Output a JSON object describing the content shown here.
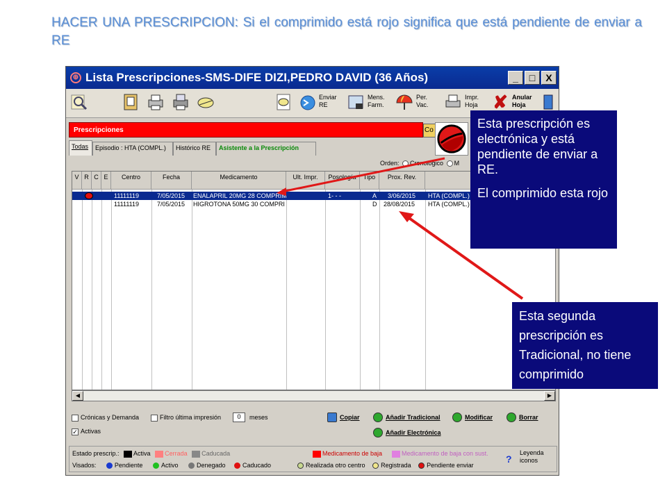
{
  "slide": {
    "title": "HACER UNA PRESCRIPCION: Si el comprimido está rojo significa que está pendiente de enviar a RE"
  },
  "window": {
    "title": "Lista Prescripciones-SMS-DIFE DIZI,PEDRO DAVID (36 Años)",
    "minimize": "_",
    "maximize": "□",
    "close": "X"
  },
  "toolbar": {
    "enviar_re": "Enviar\nRE",
    "mens_farm": "Mens.\nFarm.",
    "per_vac": "Per.\nVac.",
    "impr_hoja": "Impr.\nHoja",
    "anular_hoja": "Anular\nHoja"
  },
  "panel": {
    "header": "Prescripciones",
    "side_button": "Co"
  },
  "tabs": [
    "Todas",
    "Episodio : HTA (COMPL.)",
    "Histórico RE",
    "Asistente a la Prescripción"
  ],
  "order": {
    "label": "Orden:",
    "option1": "Cronológico",
    "option2": "M"
  },
  "table": {
    "columns": [
      "V",
      "R",
      "C",
      "E",
      "Centro",
      "Fecha",
      "Medicamento",
      "Ult. Impr.",
      "Posología",
      "Tipo",
      "Prox. Rev.",
      ""
    ],
    "rows": [
      {
        "centro": "11111119",
        "fecha": "7/05/2015",
        "medicamento": "ENALAPRIL 20MG 28 COMPRIM",
        "ult_impr": "",
        "posologia": "1- - -",
        "tipo": "A",
        "prox_rev": "3/06/2015",
        "episodio": "HTA (COMPL.)",
        "selected": true,
        "pending_pill": true
      },
      {
        "centro": "11111119",
        "fecha": "7/05/2015",
        "medicamento": "HIGROTONA 50MG 30 COMPRI",
        "ult_impr": "",
        "posologia": "",
        "tipo": "D",
        "prox_rev": "28/08/2015",
        "episodio": "HTA (COMPL.)",
        "selected": false,
        "pending_pill": false
      }
    ]
  },
  "filters": {
    "cronicas": "Crónicas y Demanda",
    "filtro": "Filtro última impresión",
    "meses_value": "0",
    "meses": "meses",
    "activas": "Activas"
  },
  "actions": {
    "copiar": "Copiar",
    "anadir_tradicional": "Añadir Tradicional",
    "modificar": "Modificar",
    "borrar": "Borrar",
    "anadir_electronica": "Añadir Electrónica"
  },
  "legend": {
    "estado_label": "Estado prescrip.:",
    "activa": "Activa",
    "cerrada": "Cerrada",
    "caducada": "Caducada",
    "med_baja": "Medicamento de baja",
    "med_baja_sust": "Medicamento de baja con sust.",
    "visados_label": "Visados:",
    "pendiente": "Pendiente",
    "activo": "Activo",
    "denegado": "Denegado",
    "caducado": "Caducado",
    "realizada": "Realizada otro centro",
    "registrada": "Registrada",
    "pendiente_enviar": "Pendiente enviar",
    "help": "?",
    "leyenda": "Leyenda\niconos"
  },
  "callouts": {
    "c1_line1": "Esta prescripción es electrónica y está pendiente de enviar a RE.",
    "c1_line2": "El comprimido esta rojo",
    "c2": "Esta segunda prescripción es Tradicional, no tiene comprimido"
  },
  "colors": {
    "title_blue": "#5b8fd6",
    "callout_bg": "#0a0a7a",
    "arrow_red": "#e01818",
    "pending_red": "#ff0000"
  }
}
